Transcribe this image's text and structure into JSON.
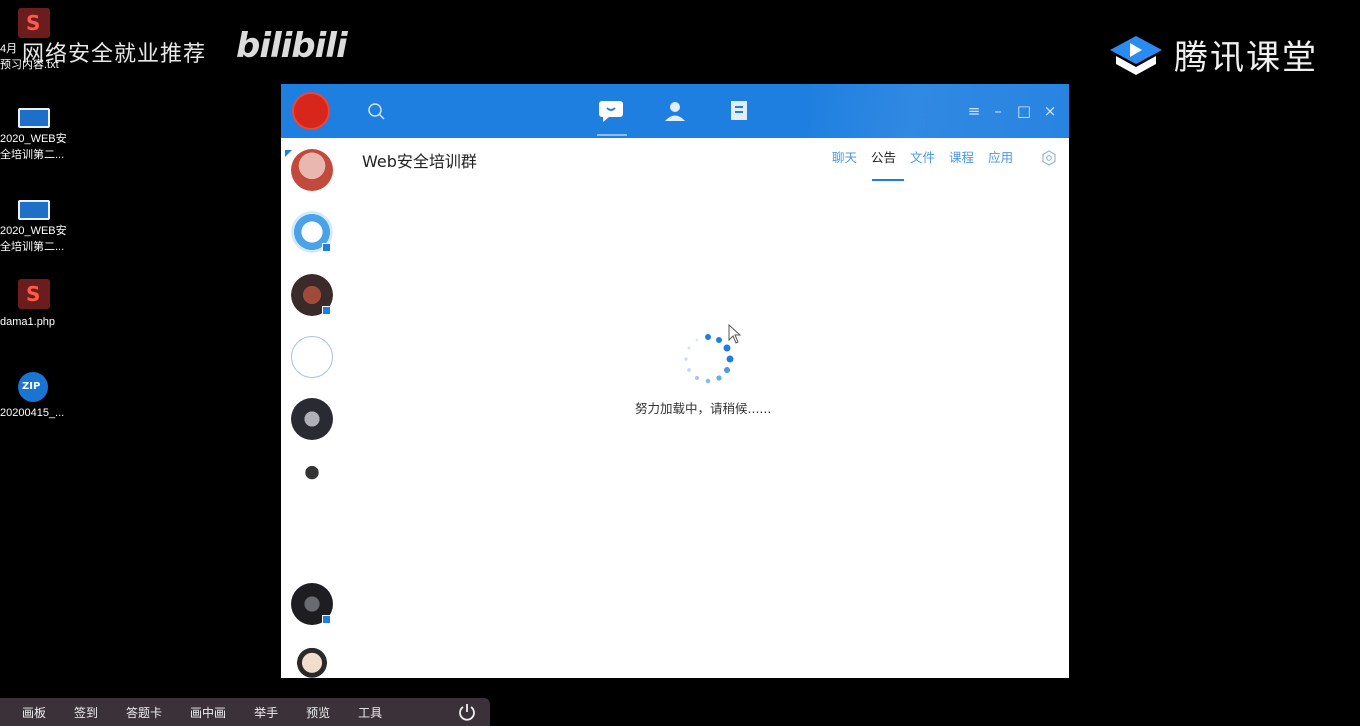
{
  "watermarks": {
    "left_text": "网络安全就业推荐",
    "bilibili": "bilibili",
    "tencent_name": "腾讯课堂"
  },
  "desktop_icons": [
    {
      "name": "4月15号课程预习内容.txt",
      "line1": "4月",
      "line2": "预习内容.txt",
      "type": "text-icon"
    },
    {
      "name": "2020_WEB安全培训第二",
      "line1": "2020_WEB安",
      "line2": "全培训第二...",
      "type": "image-icon"
    },
    {
      "name": "2020_WEB安全培训第二",
      "line1": "2020_WEB安",
      "line2": "全培训第二...",
      "type": "image-icon"
    },
    {
      "name": "dama1.php",
      "line1": "dama1.php",
      "line2": "",
      "type": "php-icon"
    },
    {
      "name": "20200415_...",
      "line1": "20200415_...",
      "line2": "",
      "type": "zip-icon"
    }
  ],
  "app": {
    "group_name": "Web安全培训群",
    "tabs": [
      "聊天",
      "公告",
      "文件",
      "课程",
      "应用"
    ],
    "active_tab": "公告",
    "loading_text": "努力加载中，请稍候......",
    "window_buttons": [
      "≡",
      "–",
      "□",
      "×"
    ]
  },
  "taskbar": {
    "items": [
      "画板",
      "签到",
      "答题卡",
      "画中画",
      "举手",
      "预览",
      "工具"
    ]
  },
  "colors": {
    "accent": "#1f7fe0",
    "titlebar": "#1f7fe0",
    "avatar_red": "#d8261c",
    "taskbar_bg": "#3a3238"
  }
}
